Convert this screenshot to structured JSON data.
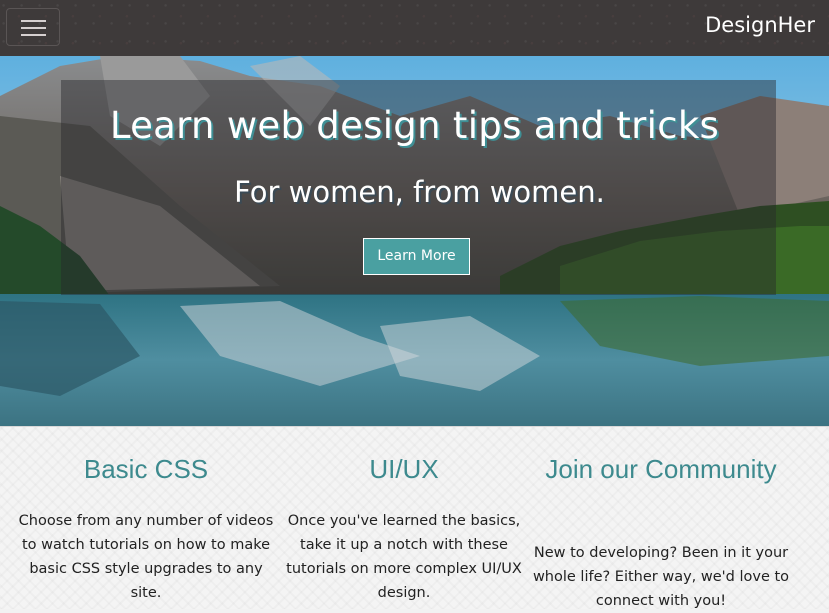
{
  "nav": {
    "brand": "DesignHer",
    "toggle_icon": "hamburger-menu-icon"
  },
  "hero": {
    "title": "Learn web design tips and tricks",
    "subtitle": "For women, from women.",
    "button_label": "Learn More"
  },
  "features": [
    {
      "heading": "Basic CSS",
      "text": "Choose from any number of videos to watch tutorials on how to make basic CSS style upgrades to any site."
    },
    {
      "heading": "UI/UX",
      "text": "Once you've learned the basics, take it up a notch with these tutorials on more complex UI/UX design."
    },
    {
      "heading": "Join our Community",
      "text": "New to developing? Been in it your whole life? Either way, we'd love to connect with you!"
    }
  ],
  "colors": {
    "navbar": "#3e3a3a",
    "accent": "#3d8a8e",
    "button": "#4aa0a1"
  }
}
